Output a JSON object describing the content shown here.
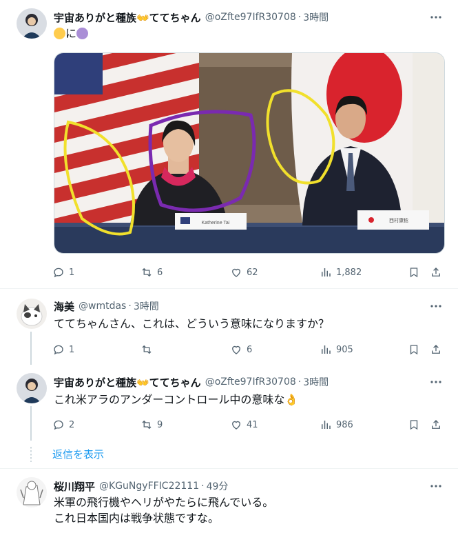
{
  "colors": {
    "text_primary": "#0f1419",
    "text_secondary": "#536471",
    "link_blue": "#1d9bf0",
    "divider": "#eff3f4",
    "emoji_yellow": "#ffcc4d",
    "emoji_purple": "#aa8ed6"
  },
  "tweets": [
    {
      "name": "宇宙ありがと種族👐ててちゃん",
      "handle": "@oZfte97IfR30708",
      "dot": "·",
      "time": "3時間",
      "text_mid": "に",
      "icons": [
        "yellow-circle-emoji",
        "purple-circle-emoji"
      ],
      "stats": {
        "replies": "1",
        "reposts": "6",
        "likes": "62",
        "views": "1,882"
      }
    },
    {
      "name": "海美",
      "handle": "@wmtdas",
      "dot": "·",
      "time": "3時間",
      "text": "ててちゃんさん、これは、どういう意味になりますか？",
      "stats": {
        "replies": "1",
        "reposts": "",
        "likes": "6",
        "views": "905"
      }
    },
    {
      "name": "宇宙ありがと種族👐ててちゃん",
      "handle": "@oZfte97IfR30708",
      "dot": "·",
      "time": "3時間",
      "text": "これ米アラのアンダーコントロール中の意味な👌",
      "stats": {
        "replies": "2",
        "reposts": "9",
        "likes": "41",
        "views": "986"
      }
    },
    {
      "name": "桜川翔平",
      "handle": "@KGuNgyFFIC22111",
      "dot": "·",
      "time": "49分",
      "text_line1": "米軍の飛行機やヘリがやたらに飛んでいる。",
      "text_line2": "これ日本国内は戦争状態ですな。"
    }
  ],
  "show_replies": "返信を表示",
  "media": {
    "nameplate_left": "Katherine Tai",
    "nameplate_right": "西村康稔"
  }
}
